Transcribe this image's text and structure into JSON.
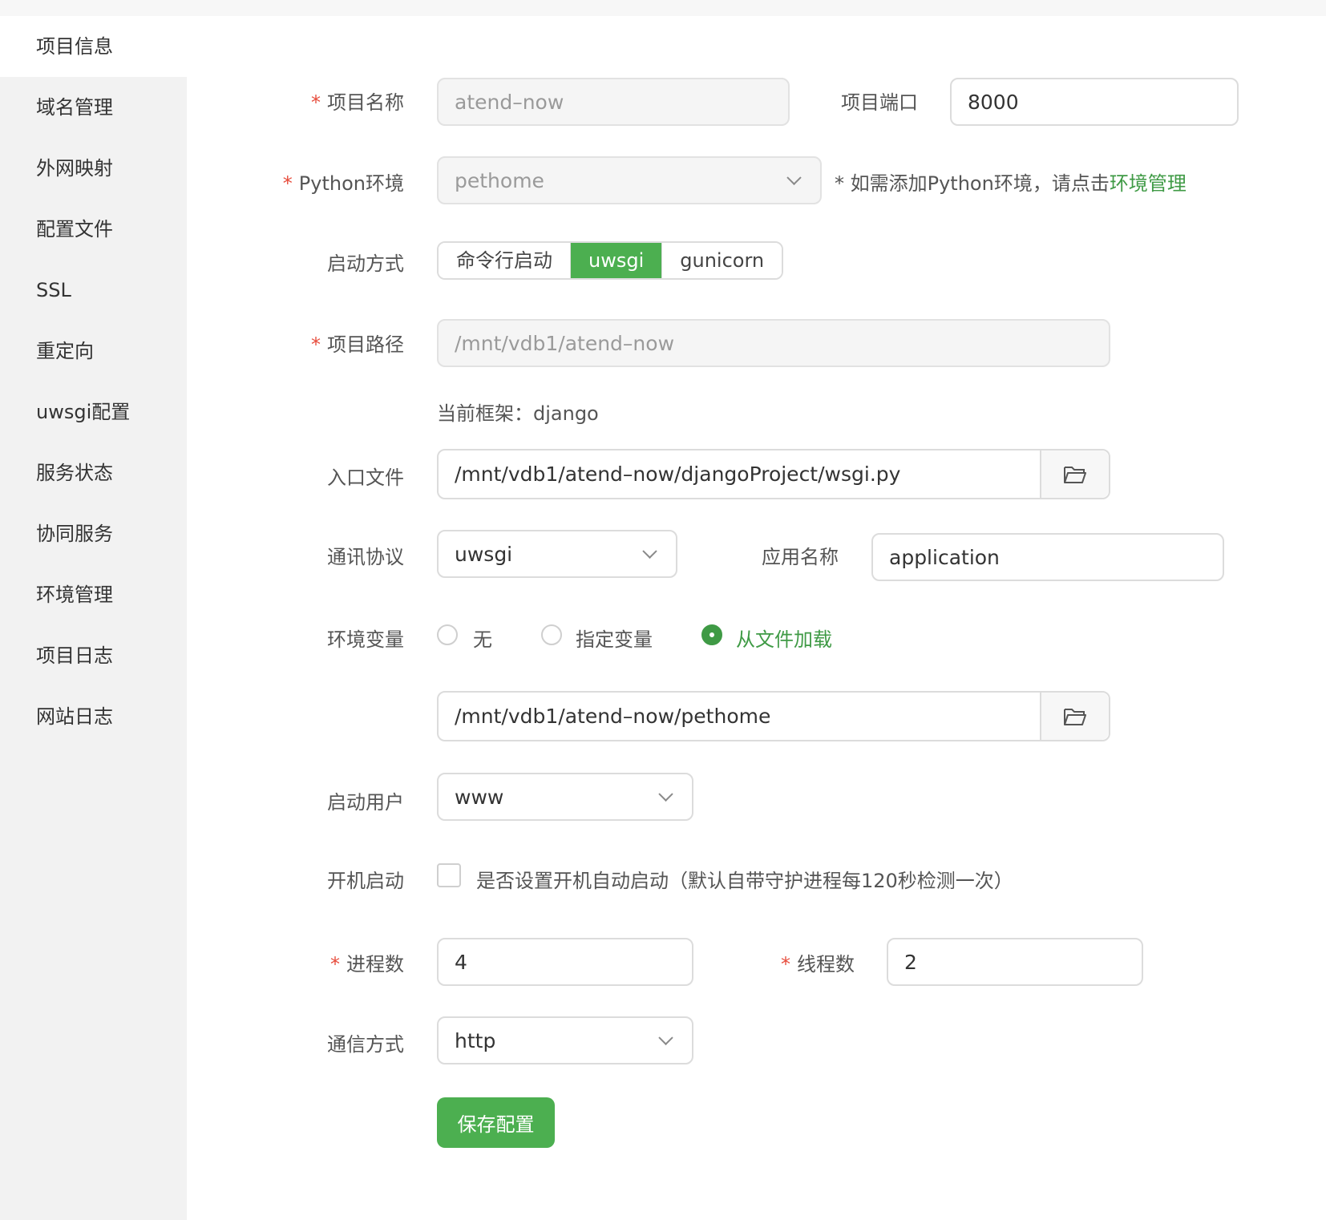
{
  "sidebar": {
    "items": [
      {
        "label": "项目信息",
        "active": true
      },
      {
        "label": "域名管理"
      },
      {
        "label": "外网映射"
      },
      {
        "label": "配置文件"
      },
      {
        "label": "SSL"
      },
      {
        "label": "重定向"
      },
      {
        "label": "uwsgi配置"
      },
      {
        "label": "服务状态"
      },
      {
        "label": "协同服务"
      },
      {
        "label": "环境管理"
      },
      {
        "label": "项目日志"
      },
      {
        "label": "网站日志"
      }
    ]
  },
  "form": {
    "required_mark": "*",
    "project_name": {
      "label": "项目名称",
      "value": "atend–now"
    },
    "project_port": {
      "label": "项目端口",
      "value": "8000"
    },
    "python_env": {
      "label": "Python环境",
      "value": "pethome",
      "hint_prefix": "* 如需添加Python环境，请点击",
      "hint_link": "环境管理"
    },
    "start_mode": {
      "label": "启动方式",
      "options": [
        "命令行启动",
        "uwsgi",
        "gunicorn"
      ],
      "selected": "uwsgi"
    },
    "project_path": {
      "label": "项目路径",
      "value": "/mnt/vdb1/atend–now"
    },
    "framework": {
      "label": "当前框架：",
      "value": "django"
    },
    "entry_file": {
      "label": "入口文件",
      "value": "/mnt/vdb1/atend–now/djangoProject/wsgi.py"
    },
    "protocol": {
      "label": "通讯协议",
      "value": "uwsgi"
    },
    "app_name": {
      "label": "应用名称",
      "value": "application"
    },
    "env_vars": {
      "label": "环境变量",
      "options": [
        "无",
        "指定变量",
        "从文件加载"
      ],
      "selected": "从文件加载",
      "file_path": "/mnt/vdb1/atend–now/pethome"
    },
    "start_user": {
      "label": "启动用户",
      "value": "www"
    },
    "autostart": {
      "label": "开机启动",
      "text": "是否设置开机自动启动（默认自带守护进程每120秒检测一次）",
      "checked": false
    },
    "processes": {
      "label": "进程数",
      "value": "4"
    },
    "threads": {
      "label": "线程数",
      "value": "2"
    },
    "comm_mode": {
      "label": "通信方式",
      "value": "http"
    },
    "save_button": "保存配置"
  },
  "colors": {
    "accent": "#4caf50",
    "link": "#3f9a45",
    "required": "#e74c3c",
    "sidebar_bg": "#f2f2f2"
  },
  "icons": {
    "folder": "folder-open-icon",
    "select": "chevron-down-icon"
  }
}
